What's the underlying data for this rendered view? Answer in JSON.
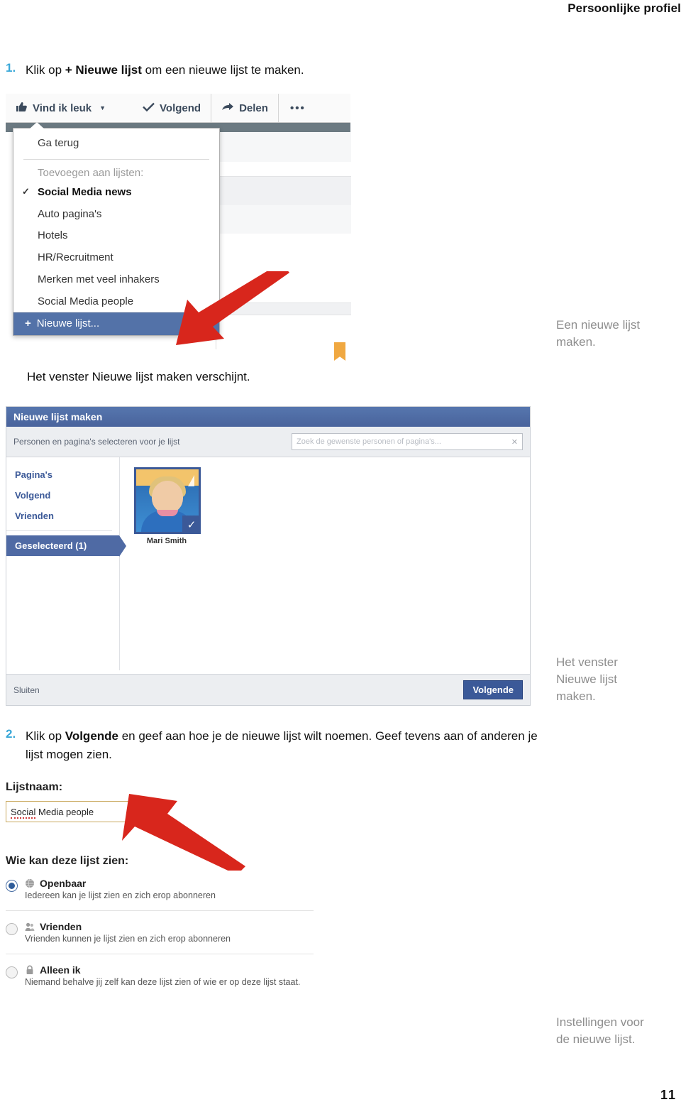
{
  "header": {
    "title": "Persoonlijke profiel"
  },
  "folio": {
    "page_number": "11"
  },
  "steps": [
    {
      "number": "1.",
      "text_before": "Klik op ",
      "bold": "+ Nieuwe lijst",
      "text_after": " om een nieuwe lijst te maken."
    },
    {
      "number": "2.",
      "text_before": "Klik op ",
      "bold": "Volgende",
      "text_after": " en geef aan hoe je de nieuwe lijst wilt noemen. Geef tevens aan of anderen je lijst mogen zien."
    }
  ],
  "body_text": {
    "after_figure1": "Het venster Nieuwe lijst maken verschijnt."
  },
  "margin_captions": [
    {
      "line1": "Een nieuwe lijst",
      "line2": "maken."
    },
    {
      "line1": "Het venster",
      "line2": "Nieuwe lijst",
      "line3": "maken."
    },
    {
      "line1": "Instellingen voor",
      "line2": "de nieuwe lijst."
    }
  ],
  "figure1": {
    "toolbar": [
      {
        "icon": "thumbs-up-icon",
        "label": "Vind ik leuk",
        "caret": "▼"
      },
      {
        "icon": "check-icon",
        "label": "Volgend"
      },
      {
        "icon": "share-arrow-icon",
        "label": "Delen"
      }
    ],
    "toolbar_more": "•••",
    "dropdown": {
      "back_label": "Ga terug",
      "section_label": "Toevoegen aan lijsten:",
      "items": [
        {
          "label": "Social Media news",
          "checked": true
        },
        {
          "label": "Auto pagina's",
          "checked": false
        },
        {
          "label": "Hotels",
          "checked": false
        },
        {
          "label": "HR/Recruitment",
          "checked": false
        },
        {
          "label": "Merken met veel inhakers",
          "checked": false
        },
        {
          "label": "Social Media people",
          "checked": false
        }
      ],
      "new_list_plus": "+",
      "new_list_label": "Nieuwe lijst..."
    }
  },
  "figure2": {
    "title": "Nieuwe lijst maken",
    "subtitle": "Personen en pagina's selecteren voor je lijst",
    "search_placeholder": "Zoek de gewenste personen of pagina's...",
    "search_clear_icon": "✕",
    "sidebar": [
      {
        "label": "Pagina's",
        "selected": false
      },
      {
        "label": "Volgend",
        "selected": false
      },
      {
        "label": "Vrienden",
        "selected": false
      },
      {
        "label": "Geselecteerd (1)",
        "selected": true
      }
    ],
    "selected_person": {
      "name": "Mari Smith",
      "check_icon": "✓"
    },
    "footer": {
      "close_label": "Sluiten",
      "next_label": "Volgende"
    }
  },
  "figure3": {
    "name_label": "Lijstnaam:",
    "name_value_mis": "Social",
    "name_value_rest": " Media people",
    "visibility_label": "Wie kan deze lijst zien:",
    "options": [
      {
        "icon": "globe-icon",
        "title": "Openbaar",
        "description": "Iedereen kan je lijst zien en zich erop abonneren",
        "selected": true
      },
      {
        "icon": "friends-icon",
        "title": "Vrienden",
        "description": "Vrienden kunnen je lijst zien en zich erop abonneren",
        "selected": false
      },
      {
        "icon": "lock-icon",
        "title": "Alleen ik",
        "description": "Niemand behalve jij zelf kan deze lijst zien of wie er op deze lijst staat.",
        "selected": false
      }
    ]
  },
  "colors": {
    "accent_step_number": "#3aa8d8",
    "facebook_blue": "#3b5998",
    "dialog_header": "#4f6aa4",
    "highlight_row": "#5372a8",
    "arrow_red": "#d8261c",
    "caption_gray": "#8e8e8e",
    "bookmark_orange": "#f0a841"
  }
}
